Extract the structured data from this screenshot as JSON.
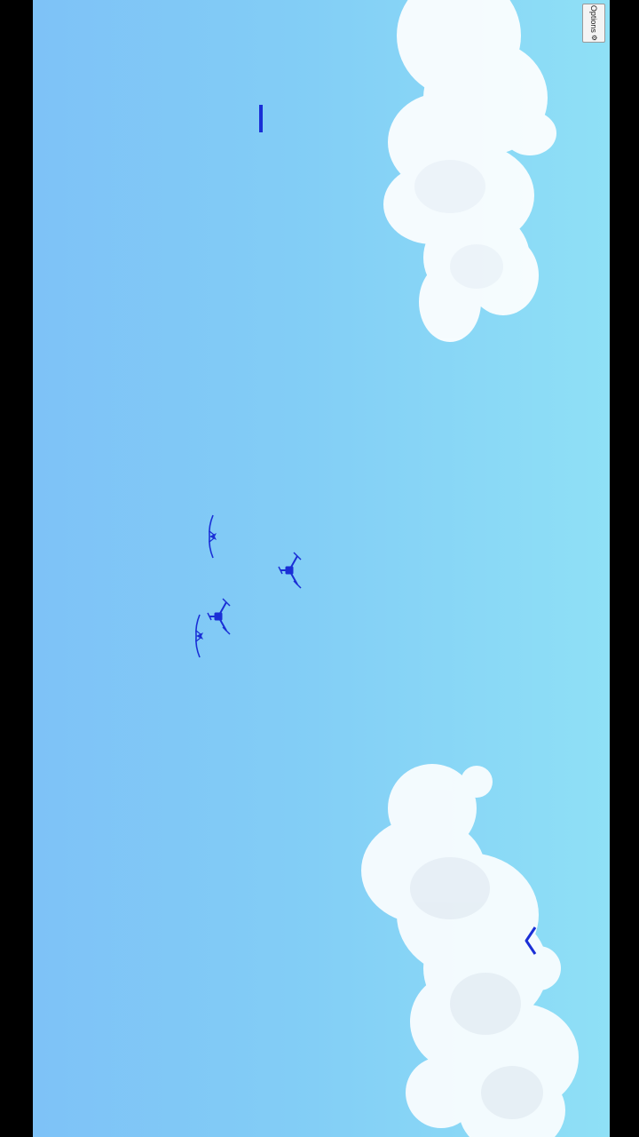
{
  "options": {
    "label": "Options",
    "icon": "gear-icon"
  },
  "colors": {
    "sky_left": "#7ec2f7",
    "sky_right": "#8fe0f6",
    "sprite": "#1a2fd6",
    "cloud": "#ffffff",
    "letterbox": "#000000"
  },
  "sprites": [
    "score-marker",
    "bird-flying-1",
    "drone-1",
    "drone-2",
    "bird-flying-2",
    "back-chevron"
  ]
}
